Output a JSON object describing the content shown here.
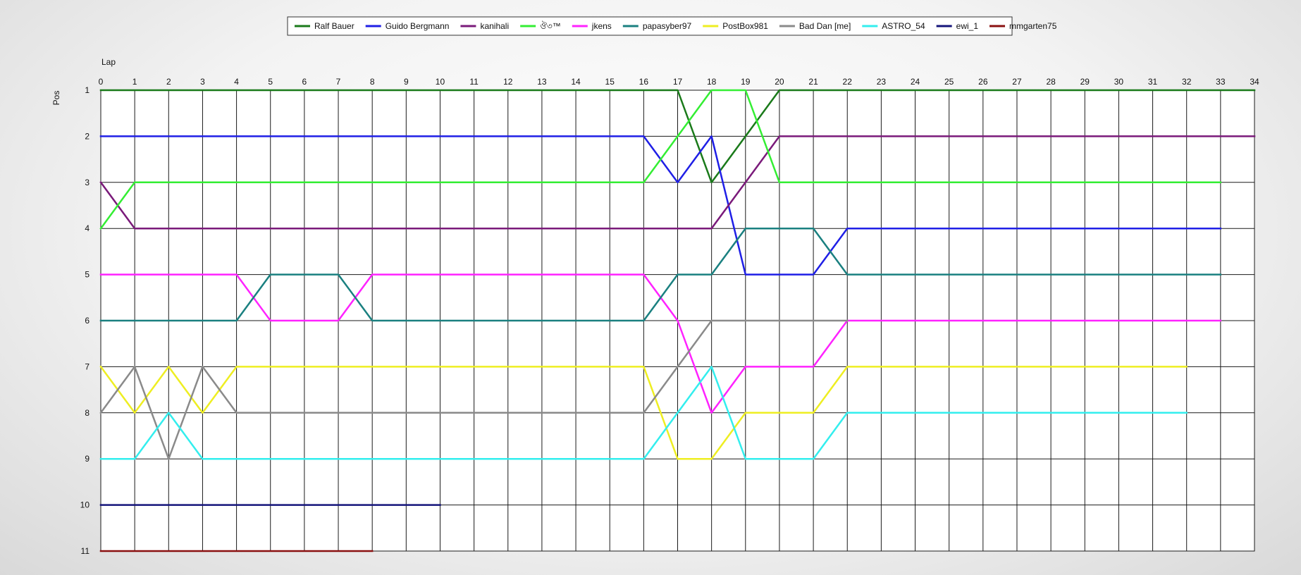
{
  "chart_data": {
    "type": "line",
    "xlabel": "Lap",
    "ylabel": "Pos",
    "xlim": [
      0,
      34
    ],
    "ylim": [
      1,
      11
    ],
    "y_inverted": true,
    "grid": true,
    "legend": "top-center",
    "x_ticks": [
      "0",
      "1",
      "2",
      "3",
      "4",
      "5",
      "6",
      "7",
      "8",
      "9",
      "10",
      "11",
      "12",
      "13",
      "14",
      "15",
      "16",
      "17",
      "18",
      "19",
      "20",
      "21",
      "22",
      "23",
      "24",
      "25",
      "26",
      "27",
      "28",
      "29",
      "30",
      "31",
      "32",
      "33",
      "34"
    ],
    "y_ticks": [
      "1",
      "2",
      "3",
      "4",
      "5",
      "6",
      "7",
      "8",
      "9",
      "10",
      "11"
    ],
    "series": [
      {
        "name": "Ralf Bauer",
        "color": "#1a7a1a",
        "x": [
          0,
          1,
          2,
          3,
          4,
          5,
          6,
          7,
          8,
          9,
          10,
          11,
          12,
          13,
          14,
          15,
          16,
          17,
          18,
          19,
          20,
          21,
          22,
          23,
          24,
          25,
          26,
          27,
          28,
          29,
          30,
          31,
          32,
          33,
          34
        ],
        "y": [
          1,
          1,
          1,
          1,
          1,
          1,
          1,
          1,
          1,
          1,
          1,
          1,
          1,
          1,
          1,
          1,
          1,
          1,
          3,
          2,
          1,
          1,
          1,
          1,
          1,
          1,
          1,
          1,
          1,
          1,
          1,
          1,
          1,
          1,
          1
        ]
      },
      {
        "name": "Guido Bergmann",
        "color": "#1f1fe6",
        "x": [
          0,
          1,
          2,
          3,
          4,
          5,
          6,
          7,
          8,
          9,
          10,
          11,
          12,
          13,
          14,
          15,
          16,
          17,
          18,
          19,
          20,
          21,
          22,
          23,
          24,
          25,
          26,
          27,
          28,
          29,
          30,
          31,
          32,
          33
        ],
        "y": [
          2,
          2,
          2,
          2,
          2,
          2,
          2,
          2,
          2,
          2,
          2,
          2,
          2,
          2,
          2,
          2,
          2,
          3,
          2,
          5,
          5,
          5,
          4,
          4,
          4,
          4,
          4,
          4,
          4,
          4,
          4,
          4,
          4,
          4
        ]
      },
      {
        "name": "kanihali",
        "color": "#7a1a7a",
        "x": [
          0,
          1,
          2,
          3,
          4,
          5,
          6,
          7,
          8,
          9,
          10,
          11,
          12,
          13,
          14,
          15,
          16,
          17,
          18,
          19,
          20,
          21,
          22,
          23,
          24,
          25,
          26,
          27,
          28,
          29,
          30,
          31,
          32,
          33,
          34
        ],
        "y": [
          3,
          4,
          4,
          4,
          4,
          4,
          4,
          4,
          4,
          4,
          4,
          4,
          4,
          4,
          4,
          4,
          4,
          4,
          4,
          3,
          2,
          2,
          2,
          2,
          2,
          2,
          2,
          2,
          2,
          2,
          2,
          2,
          2,
          2,
          2
        ]
      },
      {
        "name": "ঔ৩™",
        "color": "#33ee33",
        "x": [
          0,
          1,
          2,
          3,
          4,
          5,
          6,
          7,
          8,
          9,
          10,
          11,
          12,
          13,
          14,
          15,
          16,
          17,
          18,
          19,
          20,
          21,
          22,
          23,
          24,
          25,
          26,
          27,
          28,
          29,
          30,
          31,
          32,
          33
        ],
        "y": [
          4,
          3,
          3,
          3,
          3,
          3,
          3,
          3,
          3,
          3,
          3,
          3,
          3,
          3,
          3,
          3,
          3,
          2,
          1,
          1,
          3,
          3,
          3,
          3,
          3,
          3,
          3,
          3,
          3,
          3,
          3,
          3,
          3,
          3
        ]
      },
      {
        "name": "jkens",
        "color": "#ff22ff",
        "x": [
          0,
          1,
          2,
          3,
          4,
          5,
          6,
          7,
          8,
          9,
          10,
          11,
          12,
          13,
          14,
          15,
          16,
          17,
          18,
          19,
          20,
          21,
          22,
          23,
          24,
          25,
          26,
          27,
          28,
          29,
          30,
          31,
          32,
          33
        ],
        "y": [
          5,
          5,
          5,
          5,
          5,
          6,
          6,
          6,
          5,
          5,
          5,
          5,
          5,
          5,
          5,
          5,
          5,
          6,
          8,
          7,
          7,
          7,
          6,
          6,
          6,
          6,
          6,
          6,
          6,
          6,
          6,
          6,
          6,
          6
        ]
      },
      {
        "name": "papasyber97",
        "color": "#1a8080",
        "x": [
          0,
          1,
          2,
          3,
          4,
          5,
          6,
          7,
          8,
          9,
          10,
          11,
          12,
          13,
          14,
          15,
          16,
          17,
          18,
          19,
          20,
          21,
          22,
          23,
          24,
          25,
          26,
          27,
          28,
          29,
          30,
          31,
          32,
          33
        ],
        "y": [
          6,
          6,
          6,
          6,
          6,
          5,
          5,
          5,
          6,
          6,
          6,
          6,
          6,
          6,
          6,
          6,
          6,
          5,
          5,
          4,
          4,
          4,
          5,
          5,
          5,
          5,
          5,
          5,
          5,
          5,
          5,
          5,
          5,
          5
        ]
      },
      {
        "name": "PostBox981",
        "color": "#eeee22",
        "x": [
          0,
          1,
          2,
          3,
          4,
          5,
          6,
          7,
          8,
          9,
          10,
          11,
          12,
          13,
          14,
          15,
          16,
          17,
          18,
          19,
          20,
          21,
          22,
          23,
          24,
          25,
          26,
          27,
          28,
          29,
          30,
          31,
          32
        ],
        "y": [
          7,
          8,
          7,
          8,
          7,
          7,
          7,
          7,
          7,
          7,
          7,
          7,
          7,
          7,
          7,
          7,
          7,
          9,
          9,
          8,
          8,
          8,
          7,
          7,
          7,
          7,
          7,
          7,
          7,
          7,
          7,
          7,
          7
        ]
      },
      {
        "name": "Bad Dan [me]",
        "color": "#8a8a8a",
        "x": [
          0,
          1,
          2,
          3,
          4,
          5,
          6,
          7,
          8,
          9,
          10,
          11,
          12,
          13,
          14,
          15,
          16,
          17,
          18,
          19,
          20,
          21,
          22
        ],
        "y": [
          8,
          7,
          9,
          7,
          8,
          8,
          8,
          8,
          8,
          8,
          8,
          8,
          8,
          8,
          8,
          8,
          8,
          7,
          6,
          6,
          6,
          6,
          6
        ]
      },
      {
        "name": "ASTRO_54",
        "color": "#33eeee",
        "x": [
          0,
          1,
          2,
          3,
          4,
          5,
          6,
          7,
          8,
          9,
          10,
          11,
          12,
          13,
          14,
          15,
          16,
          17,
          18,
          19,
          20,
          21,
          22,
          23,
          24,
          25,
          26,
          27,
          28,
          29,
          30,
          31,
          32
        ],
        "y": [
          9,
          9,
          8,
          9,
          9,
          9,
          9,
          9,
          9,
          9,
          9,
          9,
          9,
          9,
          9,
          9,
          9,
          8,
          7,
          9,
          9,
          9,
          8,
          8,
          8,
          8,
          8,
          8,
          8,
          8,
          8,
          8,
          8
        ]
      },
      {
        "name": "ewi_1",
        "color": "#14147a",
        "x": [
          0,
          1,
          2,
          3,
          4,
          5,
          6,
          7,
          8,
          9,
          10
        ],
        "y": [
          10,
          10,
          10,
          10,
          10,
          10,
          10,
          10,
          10,
          10,
          10
        ]
      },
      {
        "name": "mmgarten75",
        "color": "#8a1010",
        "x": [
          0,
          1,
          2,
          3,
          4,
          5,
          6,
          7,
          8
        ],
        "y": [
          11,
          11,
          11,
          11,
          11,
          11,
          11,
          11,
          11
        ]
      }
    ]
  }
}
